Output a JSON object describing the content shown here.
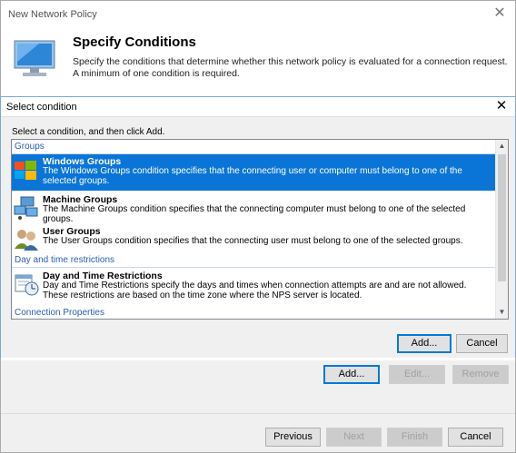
{
  "wizard": {
    "window_title": "New Network Policy",
    "heading": "Specify Conditions",
    "description": "Specify the conditions that determine whether this network policy is evaluated for a connection request. A minimum of one condition is required.",
    "add_label": "Add...",
    "edit_label": "Edit...",
    "remove_label": "Remove",
    "previous_label": "Previous",
    "next_label": "Next",
    "finish_label": "Finish",
    "cancel_label": "Cancel"
  },
  "dialog": {
    "title": "Select condition",
    "instruction": "Select a condition, and then click Add.",
    "groups": [
      {
        "label": "Groups",
        "items": [
          {
            "icon": "windows-groups-icon",
            "title": "Windows Groups",
            "desc": "The Windows Groups condition specifies that the connecting user or computer must belong to one of the selected groups.",
            "selected": true
          },
          {
            "icon": "machine-groups-icon",
            "title": "Machine Groups",
            "desc": "The Machine Groups condition specifies that the connecting computer must belong to one of the selected groups."
          },
          {
            "icon": "user-groups-icon",
            "title": "User Groups",
            "desc": "The User Groups condition specifies that the connecting user must belong to one of the selected groups."
          }
        ]
      },
      {
        "label": "Day and time restrictions",
        "items": [
          {
            "icon": "calendar-clock-icon",
            "title": "Day and Time Restrictions",
            "desc": "Day and Time Restrictions specify the days and times when connection attempts are and are not allowed. These restrictions are based on the time zone where the NPS server is located."
          }
        ]
      },
      {
        "label": "Connection Properties",
        "items": []
      }
    ],
    "add_label": "Add...",
    "cancel_label": "Cancel"
  },
  "colors": {
    "selection": "#0a75d7",
    "group_header": "#2a5db0"
  }
}
